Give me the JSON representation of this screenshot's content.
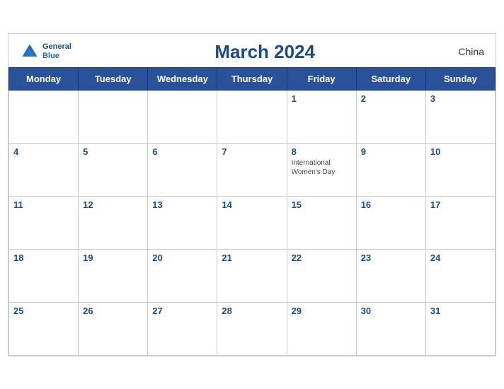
{
  "header": {
    "logo_line1": "General",
    "logo_line2": "Blue",
    "title": "March 2024",
    "country": "China"
  },
  "days_of_week": [
    "Monday",
    "Tuesday",
    "Wednesday",
    "Thursday",
    "Friday",
    "Saturday",
    "Sunday"
  ],
  "weeks": [
    [
      {
        "day": "",
        "empty": true
      },
      {
        "day": "",
        "empty": true
      },
      {
        "day": "",
        "empty": true
      },
      {
        "day": "",
        "empty": true
      },
      {
        "day": "1"
      },
      {
        "day": "2"
      },
      {
        "day": "3"
      }
    ],
    [
      {
        "day": "4"
      },
      {
        "day": "5"
      },
      {
        "day": "6"
      },
      {
        "day": "7"
      },
      {
        "day": "8",
        "event": "International Women's Day"
      },
      {
        "day": "9"
      },
      {
        "day": "10"
      }
    ],
    [
      {
        "day": "11"
      },
      {
        "day": "12"
      },
      {
        "day": "13"
      },
      {
        "day": "14"
      },
      {
        "day": "15"
      },
      {
        "day": "16"
      },
      {
        "day": "17"
      }
    ],
    [
      {
        "day": "18"
      },
      {
        "day": "19"
      },
      {
        "day": "20"
      },
      {
        "day": "21"
      },
      {
        "day": "22"
      },
      {
        "day": "23"
      },
      {
        "day": "24"
      }
    ],
    [
      {
        "day": "25"
      },
      {
        "day": "26"
      },
      {
        "day": "27"
      },
      {
        "day": "28"
      },
      {
        "day": "29"
      },
      {
        "day": "30"
      },
      {
        "day": "31"
      }
    ]
  ]
}
